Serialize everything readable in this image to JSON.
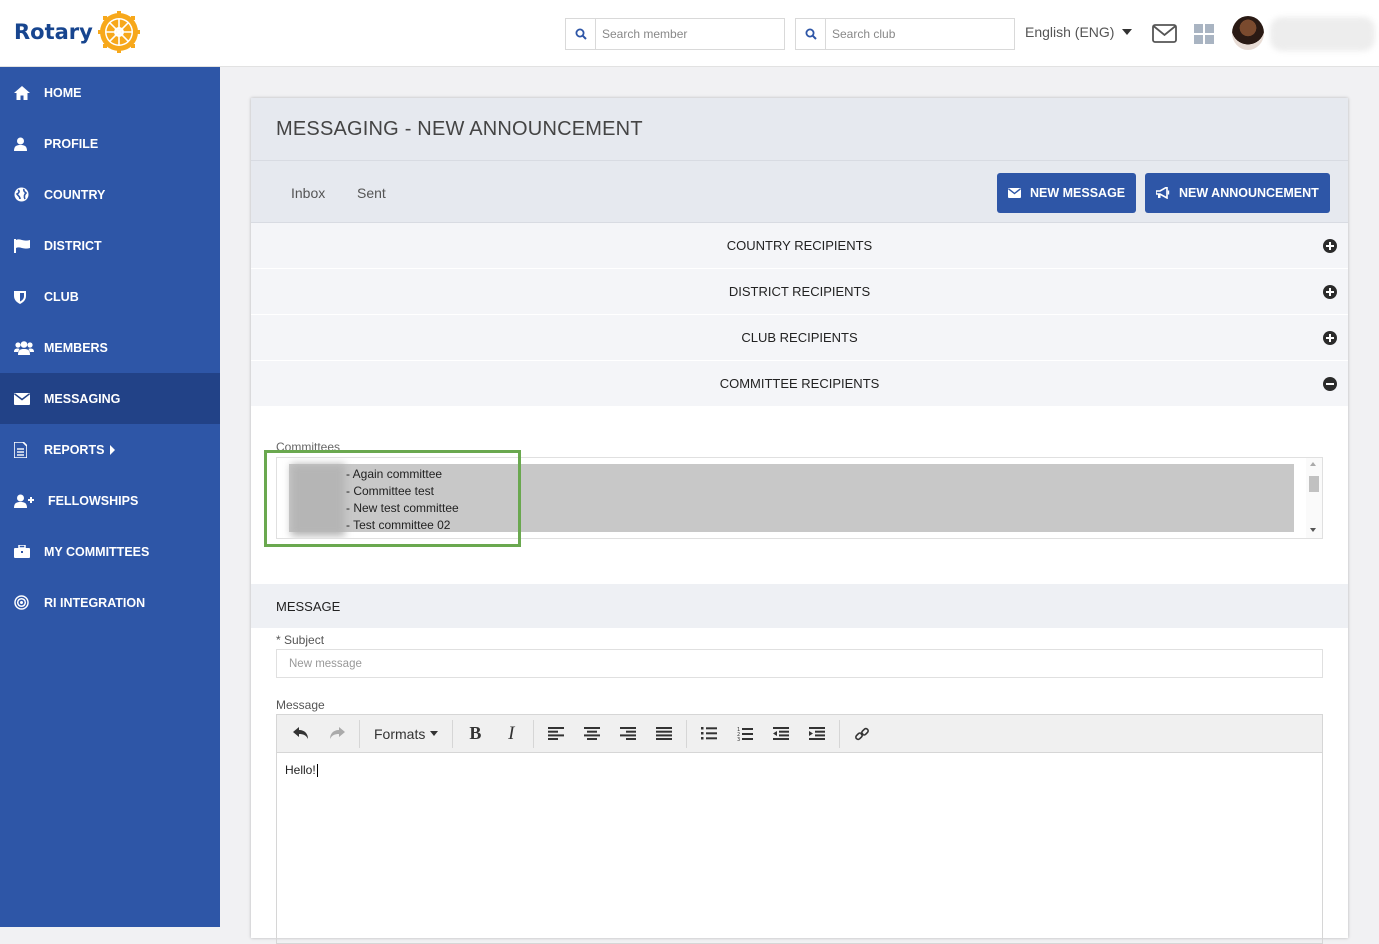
{
  "topbar": {
    "logo_text": "Rotary",
    "search_member_placeholder": "Search member",
    "search_club_placeholder": "Search club",
    "language": "English (ENG)"
  },
  "sidebar": {
    "items": [
      {
        "label": "HOME",
        "icon": "home-icon"
      },
      {
        "label": "PROFILE",
        "icon": "user-icon"
      },
      {
        "label": "COUNTRY",
        "icon": "globe-icon"
      },
      {
        "label": "DISTRICT",
        "icon": "flag-icon"
      },
      {
        "label": "CLUB",
        "icon": "shield-icon"
      },
      {
        "label": "MEMBERS",
        "icon": "users-icon"
      },
      {
        "label": "MESSAGING",
        "icon": "envelope-icon",
        "active": true
      },
      {
        "label": "REPORTS",
        "icon": "document-icon"
      },
      {
        "label": "FELLOWSHIPS",
        "icon": "user-plus-icon"
      },
      {
        "label": "MY COMMITTEES",
        "icon": "briefcase-icon"
      },
      {
        "label": "RI INTEGRATION",
        "icon": "target-icon"
      }
    ]
  },
  "page": {
    "title": "MESSAGING - NEW ANNOUNCEMENT",
    "tabs": [
      "Inbox",
      "Sent"
    ],
    "new_message_button": "NEW MESSAGE",
    "new_announcement_button": "NEW ANNOUNCEMENT"
  },
  "recipients": {
    "sections": [
      "COUNTRY RECIPIENTS",
      "DISTRICT RECIPIENTS",
      "CLUB RECIPIENTS",
      "COMMITTEE RECIPIENTS"
    ],
    "committees_label": "Committees",
    "committees": [
      "- Again committee",
      "- Committee test",
      "- New test committee",
      "- Test committee 02"
    ]
  },
  "message": {
    "section_title": "MESSAGE",
    "subject_label": "* Subject",
    "subject_placeholder": "New message",
    "message_label": "Message",
    "formats_label": "Formats",
    "body_text": "Hello!"
  },
  "colors": {
    "sidebar": "#2e56a7",
    "sidebar_active": "#224287",
    "button": "#2e56a7",
    "highlight": "#6aa84f"
  }
}
